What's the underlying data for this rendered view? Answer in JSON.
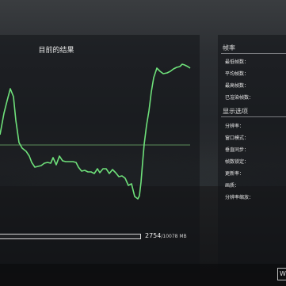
{
  "graph": {
    "title": "目前的结果",
    "line_color": "#6ee07a",
    "baseline_color": "#5c8f5c"
  },
  "memory": {
    "used": "2754",
    "total": "/10078 MB"
  },
  "framerate": {
    "header": "帧率",
    "items": [
      {
        "label": "最低帧数："
      },
      {
        "label": "平均帧数："
      },
      {
        "label": "最高帧数："
      },
      {
        "label": "已渲染帧数："
      }
    ]
  },
  "display": {
    "header": "显示选项",
    "items": [
      {
        "label": "分辨率："
      },
      {
        "label": "窗口模式："
      },
      {
        "label": "垂直同步："
      },
      {
        "label": "帧数锁定："
      },
      {
        "label": "更新率："
      },
      {
        "label": "画质："
      },
      {
        "label": "分辨率缩放："
      }
    ]
  },
  "corner_key": "W"
}
